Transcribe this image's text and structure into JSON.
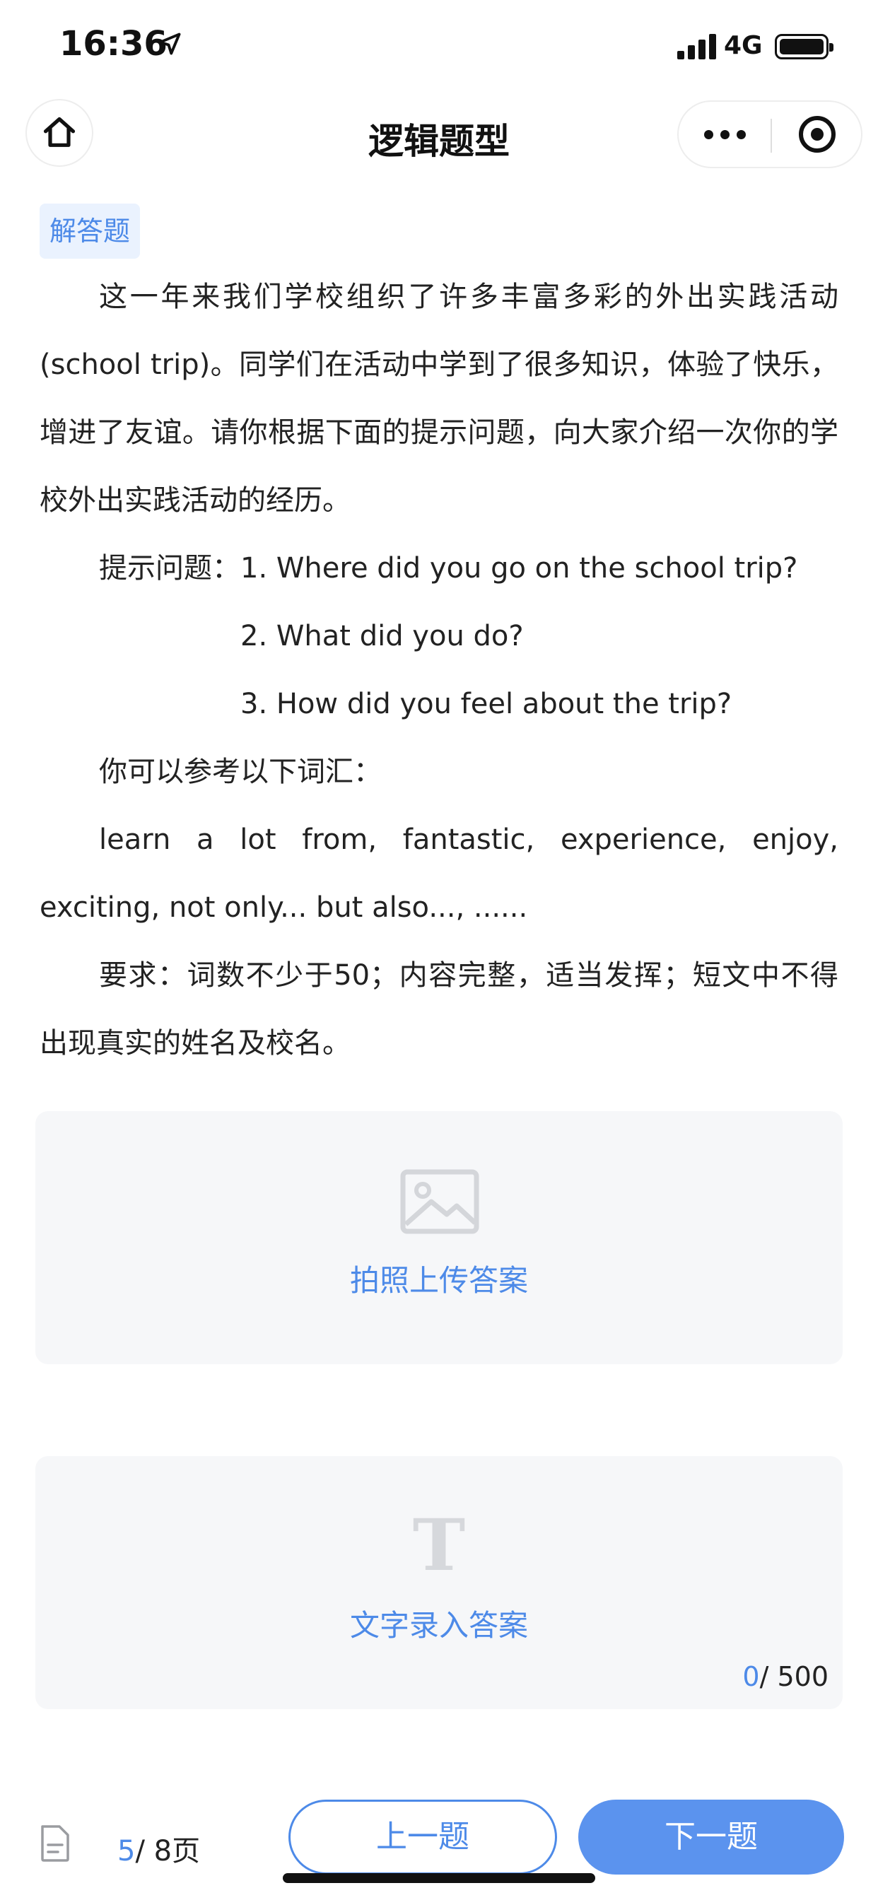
{
  "status_bar": {
    "time": "16:36",
    "network": "4G"
  },
  "nav": {
    "title": "逻辑题型",
    "home_icon": "home-icon",
    "more_icon": "more-dots-icon",
    "close_icon": "target-close-icon"
  },
  "question": {
    "type_tag": "解答题",
    "intro": "这一年来我们学校组织了许多丰富多彩的外出实践活动(school trip)。同学们在活动中学到了很多知识，体验了快乐，增进了友谊。请你根据下面的提示问题，向大家介绍一次你的学校外出实践活动的经历。",
    "hint_prefix": "提示问题：",
    "hint_1": "1. Where did you go on the school trip?",
    "hint_2": "2. What did you do?",
    "hint_3": "3. How did you feel about the trip?",
    "vocab_label": "你可以参考以下词汇：",
    "vocab": "learn a lot from, fantastic, experience, enjoy, exciting, not only... but also..., ......",
    "requirement": "要求：词数不少于50；内容完整，适当发挥；短文中不得出现真实的姓名及校名。"
  },
  "photo_upload": {
    "label": "拍照上传答案",
    "icon": "image-icon"
  },
  "text_entry": {
    "label": "文字录入答案",
    "icon": "text-t-icon",
    "count_current": "0",
    "count_max": "/ 500"
  },
  "footer": {
    "page_current": "5",
    "page_total": "/ 8页",
    "prev_label": "上一题",
    "next_label": "下一题",
    "doc_icon": "document-icon"
  },
  "colors": {
    "accent": "#4d8ae8",
    "primary_button": "#5b93ee",
    "card_bg": "#f6f7f9",
    "tag_bg": "#eaf2fe"
  }
}
